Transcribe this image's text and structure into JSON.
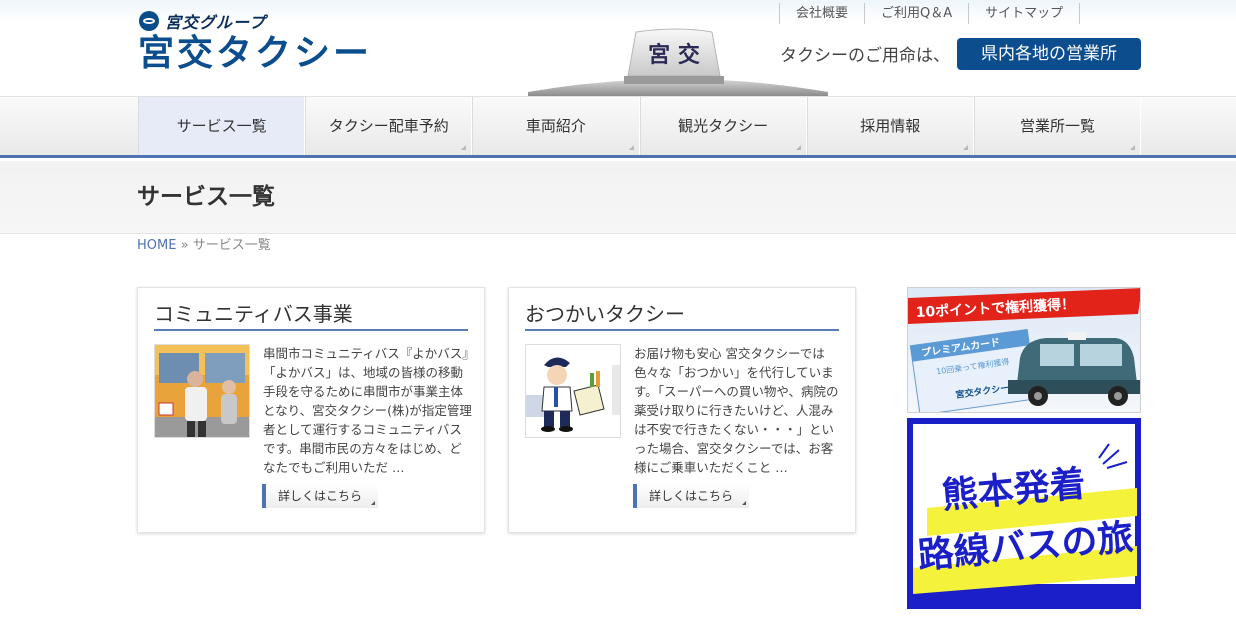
{
  "header": {
    "group_name": "宮交グループ",
    "logo_text": "宮交タクシー",
    "top_links": [
      "会社概要",
      "ご利用Q＆A",
      "サイトマップ"
    ],
    "taxi_sign_text": "宮 交",
    "call_text": "タクシーのご用命は、",
    "office_button": "県内各地の営業所"
  },
  "nav": {
    "items": [
      "サービス一覧",
      "タクシー配車予約",
      "車両紹介",
      "観光タクシー",
      "採用情報",
      "営業所一覧"
    ]
  },
  "page": {
    "title": "サービス一覧",
    "breadcrumb_home": "HOME",
    "breadcrumb_sep": "»",
    "breadcrumb_current": "サービス一覧"
  },
  "cards": [
    {
      "title": "コミュニティバス事業",
      "text": "串間市コミュニティバス『よかバス』「よかバス」は、地域の皆様の移動手段を守るために串間市が事業主体となり、宮交タクシー(株)が指定管理者として運行するコミュニティバスです。串間市民の方々をはじめ、どなたでもご利用いただ …",
      "button": "詳しくはこちら"
    },
    {
      "title": "おつかいタクシー",
      "text": "お届け物も安心 宮交タクシーでは色々な「おつかい」を代行しています。「スーパーへの買い物や、病院の薬受け取りに行きたいけど、人混みは不安で行きたくない・・・」といった場合、宮交タクシーでは、お客様にご乗車いただくこと …",
      "button": "詳しくはこちら"
    }
  ],
  "banners": {
    "premium": {
      "ribbon": "10ポイントで権利獲得！",
      "card_title": "プレミアムカード",
      "card_sub": "10回乗って権利獲得",
      "card_brand": "宮交タクシー"
    },
    "bus_tour": {
      "line1": "熊本発着",
      "line2": "路線バスの旅"
    }
  },
  "colors": {
    "brand_blue": "#0b4d8d",
    "nav_accent": "#4d73b0",
    "tour_blue": "#1a1fc8",
    "tour_yellow": "#f4f23a"
  }
}
